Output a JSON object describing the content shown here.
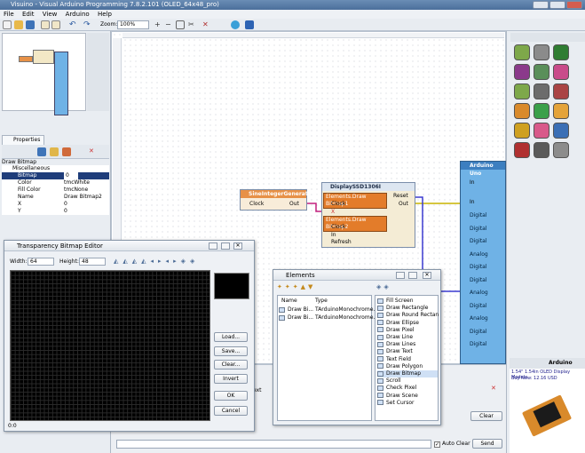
{
  "window": {
    "title": "Visuino - Visual Arduino Programming 7.8.2.101 (OLED_64x48_pro)"
  },
  "menu": [
    "File",
    "Edit",
    "View",
    "Arduino",
    "Help"
  ],
  "toolbar": {
    "zoom_label": "Zoom:",
    "zoom_value": "100%"
  },
  "properties": {
    "tab": "Properties",
    "object": "Draw Bitmap",
    "rows": [
      {
        "key": "Miscellaneous",
        "value": ""
      },
      {
        "key": "Bitmap",
        "value": "0"
      },
      {
        "key": "Color",
        "value": "tmcWhite"
      },
      {
        "key": "Fill Color",
        "value": "tmcNone"
      },
      {
        "key": "Name",
        "value": "Draw Bitmap2"
      },
      {
        "key": "X",
        "value": "0"
      },
      {
        "key": "Y",
        "value": "0"
      }
    ]
  },
  "canvas": {
    "sine": {
      "title": "SineIntegerGenerator1",
      "clock": "Clock",
      "out": "Out"
    },
    "display": {
      "title": "DisplaySSD1306I",
      "item1": "Elements.Draw Bitmap1",
      "item2": "Elements.Draw Bitmap2",
      "clock": "Clock",
      "x": "X",
      "in": "In",
      "refresh": "Refresh",
      "reset": "Reset",
      "out": "Out"
    },
    "arduino": {
      "title": "Arduino Uno",
      "in": "In",
      "pins": [
        "Digital",
        "Digital",
        "Digital",
        "Analog",
        "Digital",
        "Digital",
        "Analog",
        "Digital",
        "Analog",
        "Digital",
        "Digital"
      ]
    }
  },
  "bitmap_editor": {
    "title": "Transparency Bitmap Editor",
    "width_label": "Width:",
    "width_value": "64",
    "height_label": "Height:",
    "height_value": "48",
    "buttons": [
      "Load...",
      "Save...",
      "Clear...",
      "Invert",
      "OK",
      "Cancel"
    ],
    "status": "0:0"
  },
  "elements_dialog": {
    "title": "Elements",
    "columns": [
      "Name",
      "Type"
    ],
    "rows": [
      {
        "name": "Draw Bi...",
        "type": "TArduinoMonochrome..."
      },
      {
        "name": "Draw Bi...",
        "type": "TArduinoMonochrome..."
      }
    ],
    "palette": [
      "Fill Screen",
      "Draw Rectangle",
      "Draw Round Rectan",
      "Draw Ellipse",
      "Draw Pixel",
      "Draw Line",
      "Draw Lines",
      "Draw Text",
      "Text Field",
      "Draw Polygon",
      "Draw Bitmap",
      "Scroll",
      "Check Pixel",
      "Draw Scene",
      "Set Cursor"
    ],
    "selected": "Draw Bitmap"
  },
  "bottom": {
    "clear_label": "Clear",
    "auto_clear": "Auto Clear",
    "send": "Send",
    "tab_fragment": "ext"
  },
  "right": {
    "arduino_label": "Arduino",
    "product_line1": "1.54\" 1.54in OLED Display Module",
    "product_line2": "Buy Now: 12.16 USD"
  },
  "colors": {
    "accent": "#4b6f9b",
    "pin_red": "#d9443a",
    "elem_orange": "#e37c2a",
    "wire_blue": "#3b3bd1",
    "wire_pink": "#c3207f",
    "arduino_blue": "#6fb2e6",
    "grid_black": "#000000"
  }
}
